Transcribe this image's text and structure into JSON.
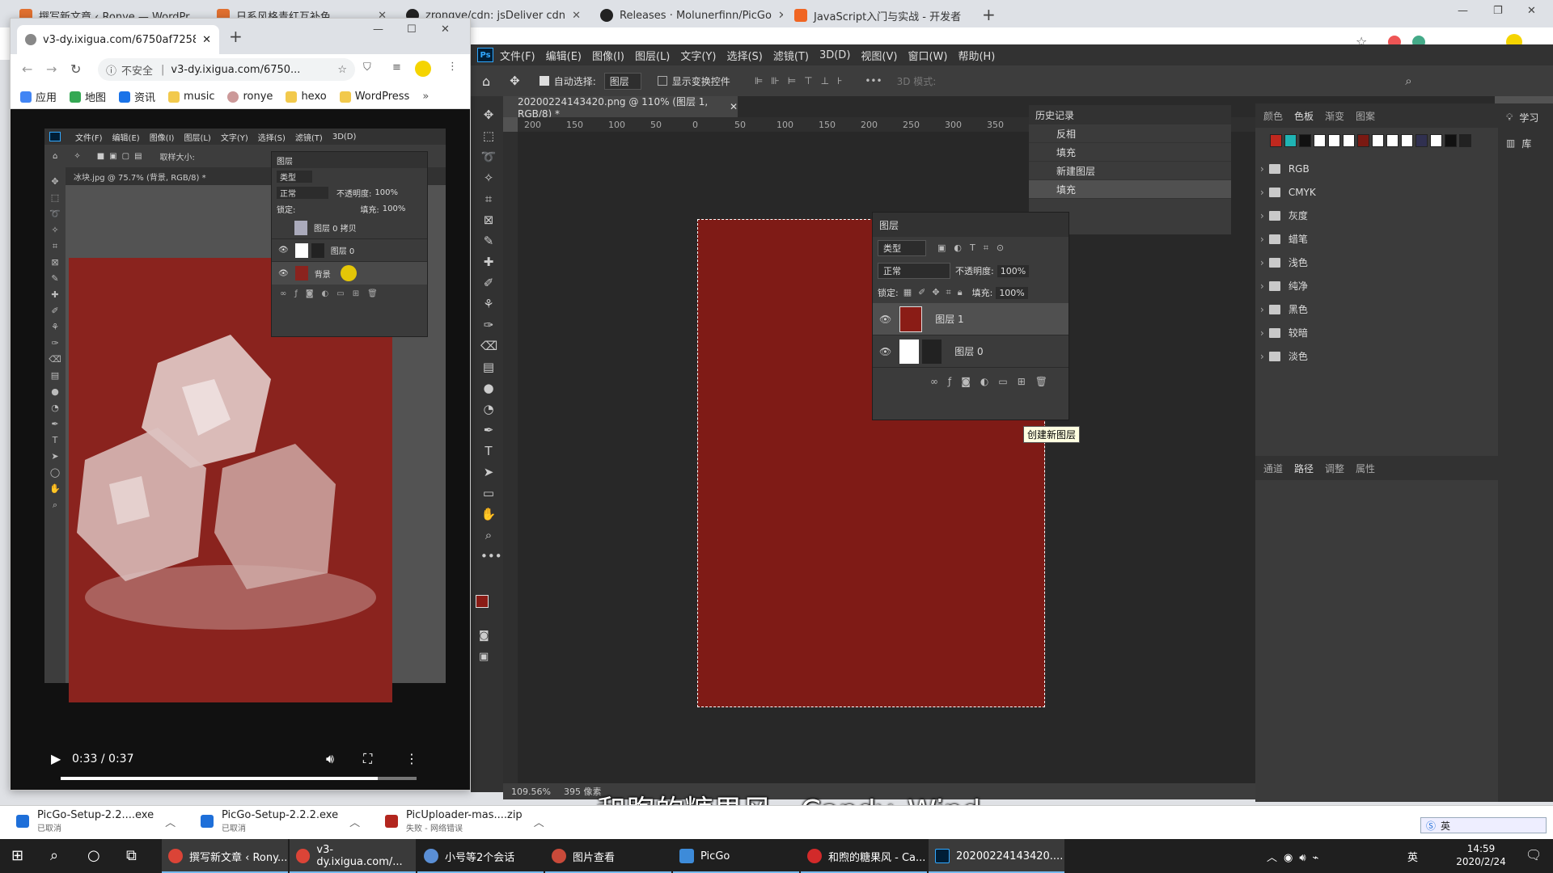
{
  "back_browser": {
    "tabs": [
      {
        "label": "撰写新文章 ‹ Ronye — WordPr"
      },
      {
        "label": "日系风格青红互补色"
      },
      {
        "label": "zrongye/cdn: jsDeliver cdn"
      },
      {
        "label": "Releases · Molunerfinn/PicGo"
      },
      {
        "label": "JavaScript入门与实战 - 开发者"
      }
    ]
  },
  "left_browser": {
    "tab_title": "v3-dy.ixigua.com/6750af7258",
    "insecure_label": "不安全",
    "url": "v3-dy.ixigua.com/6750...",
    "bookmarks": [
      {
        "label": "应用",
        "icon": "apps-icon"
      },
      {
        "label": "地图",
        "icon": "maps-icon"
      },
      {
        "label": "资讯",
        "icon": "news-icon"
      },
      {
        "label": "music",
        "icon": "folder-icon"
      },
      {
        "label": "ronye",
        "icon": "avatar-icon"
      },
      {
        "label": "hexo",
        "icon": "folder-icon"
      },
      {
        "label": "WordPress",
        "icon": "folder-icon"
      }
    ],
    "video": {
      "time": "0:33 / 0:37",
      "progress": 0.89,
      "mini_ps": {
        "menu": [
          "文件(F)",
          "编辑(E)",
          "图像(I)",
          "图层(L)",
          "文字(Y)",
          "选择(S)",
          "滤镜(T)",
          "3D(D)"
        ],
        "doc_tab": "冰块.jpg @ 75.7% (背景, RGB/8) *",
        "layers_title": "图层",
        "layer_filter": "类型",
        "blend_mode": "正常",
        "opacity_label": "不透明度:",
        "opacity": "100%",
        "lock_label": "锁定:",
        "fill_label": "填充:",
        "fill": "100%",
        "layers": [
          "图层 0 拷贝",
          "图层 0",
          "背景"
        ],
        "option_text": "取样大小:"
      }
    }
  },
  "photoshop": {
    "logo": "Ps",
    "menu": [
      "文件(F)",
      "编辑(E)",
      "图像(I)",
      "图层(L)",
      "文字(Y)",
      "选择(S)",
      "滤镜(T)",
      "3D(D)",
      "视图(V)",
      "窗口(W)",
      "帮助(H)"
    ],
    "options": {
      "auto_select_label": "自动选择:",
      "auto_select_value": "图层",
      "show_transform_label": "显示变换控件",
      "mode_3d": "3D 模式:"
    },
    "doc_tab": "20200224143420.png @ 110% (图层 1, RGB/8) *",
    "ruler_ticks": [
      "200",
      "150",
      "100",
      "50",
      "0",
      "50",
      "100",
      "150",
      "200",
      "250",
      "300",
      "350"
    ],
    "zoom": "109.56%",
    "doc_info": "395 像素",
    "history": {
      "title": "历史记录",
      "items": [
        "反相",
        "填充",
        "新建图层",
        "填充"
      ]
    },
    "layers_panel": {
      "title": "图层",
      "filter": "类型",
      "blend_mode": "正常",
      "opacity_label": "不透明度:",
      "opacity": "100%",
      "lock_label": "锁定:",
      "fill_label": "填充:",
      "fill": "100%",
      "layers": [
        "图层 1",
        "图层 0"
      ],
      "tooltip": "创建新图层"
    },
    "swatches": {
      "tabs": [
        "颜色",
        "色板",
        "渐变",
        "图案"
      ],
      "colors": [
        "#c0281e",
        "#1fb3b3",
        "#111111",
        "#ffffff",
        "#ffffff",
        "#ffffff",
        "#7a1912",
        "#ffffff",
        "#ffffff",
        "#ffffff",
        "#303050",
        "#ffffff",
        "#111111",
        "#222222"
      ],
      "groups": [
        "RGB",
        "CMYK",
        "灰度",
        "蜡笔",
        "浅色",
        "纯净",
        "黑色",
        "较暗",
        "淡色"
      ]
    },
    "paths": {
      "tabs": [
        "通道",
        "路径",
        "调整",
        "属性"
      ]
    },
    "learn": {
      "label": "学习",
      "library": "库"
    }
  },
  "downloads": [
    {
      "name": "PicGo-Setup-2.2....exe",
      "status": "已取消"
    },
    {
      "name": "PicGo-Setup-2.2.2.exe",
      "status": "已取消"
    },
    {
      "name": "PicUploader-mas....zip",
      "status": "失败 - 网络错误"
    }
  ],
  "subtitle": "和煦的糖果风 - Candy_Wind",
  "taskbar": {
    "items": [
      {
        "label": "撰写新文章 ‹ Rony..."
      },
      {
        "label": "v3-dy.ixigua.com/..."
      },
      {
        "label": "小号等2个会话"
      },
      {
        "label": "图片查看"
      },
      {
        "label": "PicGo"
      },
      {
        "label": "和煦的糖果风 - Ca..."
      },
      {
        "label": "20200224143420...."
      }
    ],
    "ime": "英",
    "time": "14:59",
    "date": "2020/2/24"
  }
}
